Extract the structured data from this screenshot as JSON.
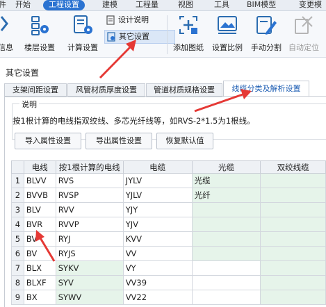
{
  "menubar": {
    "items": [
      {
        "label": "件",
        "active": false
      },
      {
        "label": "开始",
        "active": false
      },
      {
        "label": "工程设置",
        "active": true
      },
      {
        "label": "建模",
        "active": false
      },
      {
        "label": "工程量",
        "active": false
      },
      {
        "label": "视图",
        "active": false
      },
      {
        "label": "工具",
        "active": false
      },
      {
        "label": "BIM模型",
        "active": false
      },
      {
        "label": "变更模",
        "active": false
      }
    ]
  },
  "ribbon": {
    "info_label": "信息",
    "floor_settings": "楼层设置",
    "calc_settings": "计算设置",
    "design_notes": "设计说明",
    "other_settings": "其它设置",
    "add_drawing": "添加图纸",
    "set_scale": "设置比例",
    "manual_split": "手动分割",
    "auto_locate": "自动定位"
  },
  "dialog": {
    "title": "其它设置",
    "tabs": [
      "支架间距设置",
      "风管材质厚度设置",
      "管道材质规格设置",
      "线缆分类及解析设置"
    ],
    "active_tab": 3,
    "group_title": "说明",
    "description": "按1根计算的电线指双绞线、多芯光纤线等，如RVS-2*1.5为1根线。",
    "buttons": {
      "import": "导入属性设置",
      "export": "导出属性设置",
      "reset": "恢复默认值"
    }
  },
  "table": {
    "headers": [
      "",
      "电线",
      "按1根计算的电线",
      "电缆",
      "光缆",
      "双绞线缆"
    ],
    "rows": [
      {
        "n": "1",
        "wire": "BLVV",
        "single": "RVS",
        "cable": "JYLV",
        "fiber": "光缆",
        "twisted": ""
      },
      {
        "n": "2",
        "wire": "BVVB",
        "single": "RVSP",
        "cable": "YJLV",
        "fiber": "光纤",
        "twisted": ""
      },
      {
        "n": "3",
        "wire": "BLV",
        "single": "RVV",
        "cable": "YJY",
        "fiber": "",
        "twisted": ""
      },
      {
        "n": "4",
        "wire": "BVR",
        "single": "RVVP",
        "cable": "YJV",
        "fiber": "",
        "twisted": ""
      },
      {
        "n": "5",
        "wire": "BV",
        "single": "RYJ",
        "cable": "KVV",
        "fiber": "",
        "twisted": ""
      },
      {
        "n": "6",
        "wire": "BV",
        "single": "RYJS",
        "cable": "VV",
        "fiber": "",
        "twisted": ""
      },
      {
        "n": "7",
        "wire": "BLX",
        "single": "SYKV",
        "cable": "VY",
        "fiber": "",
        "twisted": ""
      },
      {
        "n": "8",
        "wire": "BLXF",
        "single": "SYV",
        "cable": "VV39",
        "fiber": "",
        "twisted": ""
      },
      {
        "n": "9",
        "wire": "BX",
        "single": "SYWV",
        "cable": "VV22",
        "fiber": "",
        "twisted": ""
      }
    ]
  },
  "colors": {
    "accent": "#2b73d1",
    "annotation": "#e53935",
    "green_cell": "#e6f4ea"
  }
}
